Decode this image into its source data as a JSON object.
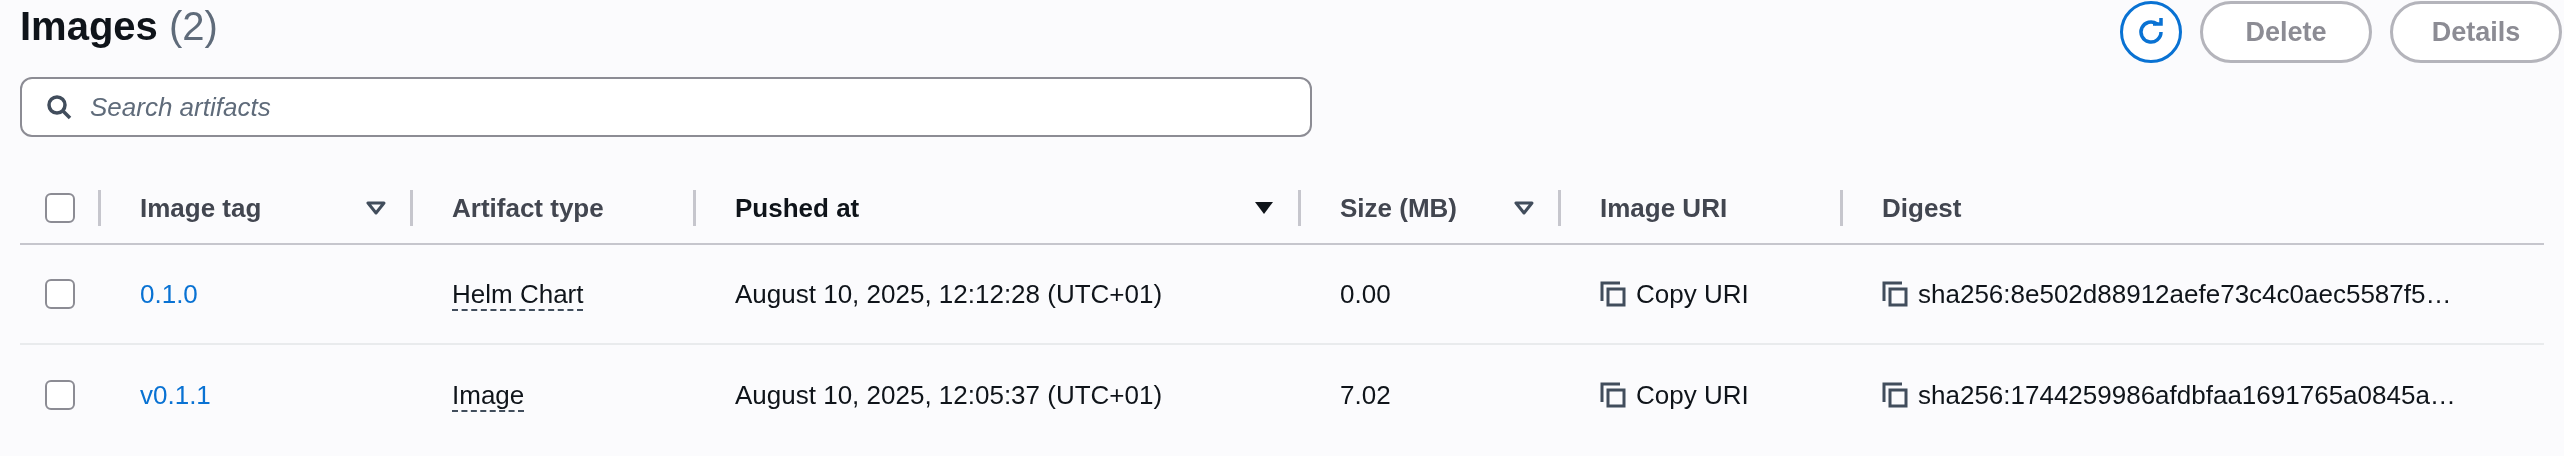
{
  "header": {
    "title": "Images",
    "count": "(2)",
    "buttons": [
      "Delete",
      "Details"
    ]
  },
  "search": {
    "placeholder": "Search artifacts"
  },
  "table": {
    "select_all": {
      "checked": false
    },
    "columns": [
      {
        "label": "Image tag",
        "sortable": true,
        "sorted": false
      },
      {
        "label": "Artifact type",
        "sortable": false
      },
      {
        "label": "Pushed at",
        "sortable": true,
        "sorted": true
      },
      {
        "label": "Size (MB)",
        "sortable": true,
        "sorted": false
      },
      {
        "label": "Image URI",
        "sortable": false
      },
      {
        "label": "Digest",
        "sortable": false
      }
    ],
    "rows": [
      {
        "checked": false,
        "tag": "0.1.0",
        "artifact_type": "Helm Chart",
        "pushed_at": "August 10, 2025, 12:12:28 (UTC+01)",
        "size": "0.00",
        "uri": "Copy URI",
        "digest": "sha256:8e502d88912aefe73c4c0aec5587f5…"
      },
      {
        "checked": false,
        "tag": "v0.1.1",
        "artifact_type": "Image",
        "pushed_at": "August 10, 2025, 12:05:37 (UTC+01)",
        "size": "7.02",
        "uri": "Copy URI",
        "digest": "sha256:1744259986afdbfaa1691765a0845a…"
      }
    ]
  }
}
